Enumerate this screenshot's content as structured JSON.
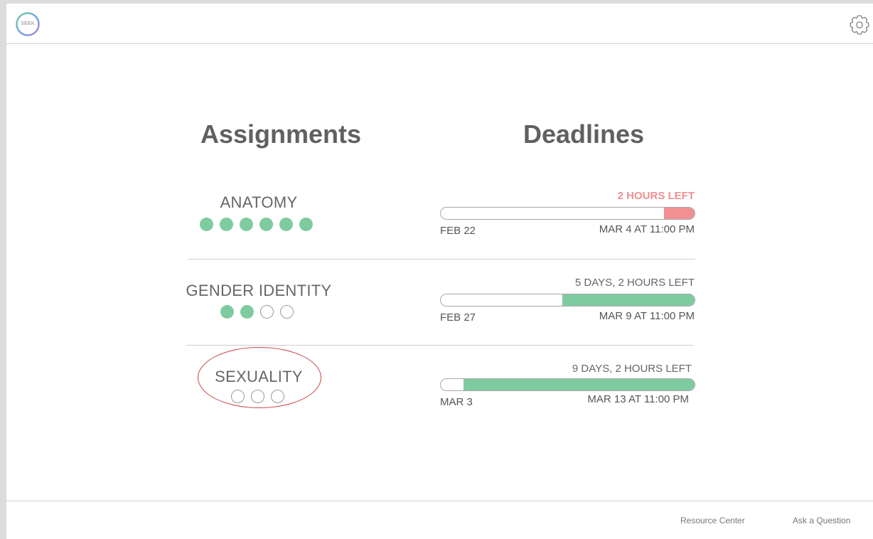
{
  "header": {
    "logo_text": "SEEK",
    "logo_colors": [
      "#7fcba0",
      "#6aa8e0",
      "#b07fd8"
    ],
    "settings_icon": "gear-icon"
  },
  "titles": {
    "assignments": "Assignments",
    "deadlines": "Deadlines"
  },
  "colors": {
    "complete": "#7fcba0",
    "urgent": "#f09092"
  },
  "assignments": [
    {
      "name": "ANATOMY",
      "progress": {
        "completed": 6,
        "total": 6
      },
      "deadline": {
        "time_left": "2 HOURS LEFT",
        "urgent": true,
        "start_date": "FEB 22",
        "end_date": "MAR 4 AT 11:00 PM",
        "remaining_fraction": 0.12
      }
    },
    {
      "name": "GENDER IDENTITY",
      "progress": {
        "completed": 2,
        "total": 4
      },
      "deadline": {
        "time_left": "5 DAYS, 2 HOURS LEFT",
        "urgent": false,
        "start_date": "FEB 27",
        "end_date": "MAR 9 AT 11:00 PM",
        "remaining_fraction": 0.52
      }
    },
    {
      "name": "SEXUALITY",
      "progress": {
        "completed": 0,
        "total": 3
      },
      "deadline": {
        "time_left": "9 DAYS, 2 HOURS LEFT",
        "urgent": false,
        "start_date": "MAR 3",
        "end_date": "MAR 13 AT 11:00 PM",
        "remaining_fraction": 0.91
      }
    }
  ],
  "footer": {
    "resource_center": "Resource Center",
    "ask_question": "Ask a Question"
  }
}
